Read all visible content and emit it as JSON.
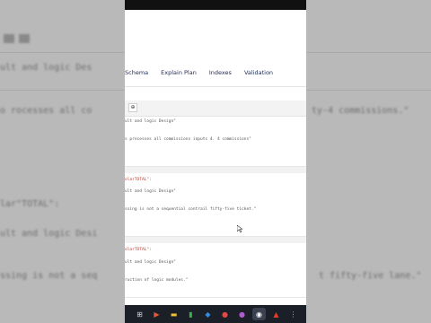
{
  "backdrop": {
    "left_lines": [
      "ult and logic Des",
      "o rocesses all co",
      "lar\"TOTAL\":",
      "ult and logic Desi",
      "ssing is not a seq"
    ],
    "right_lines": [
      "",
      "",
      "",
      "",
      "l\"lane.\""
    ]
  },
  "tabs": [
    {
      "label": "Schema"
    },
    {
      "label": "Explain Plan"
    },
    {
      "label": "Indexes"
    },
    {
      "label": "Validation"
    }
  ],
  "toolbar": {
    "button_glyph": "⊕"
  },
  "results": [
    {
      "line1": "ult and logic Design\"",
      "line2": "s processes all commissions inputs 4. 4 commissions\""
    },
    {
      "key": "olarTOTAL\":",
      "line1": "ult and logic Design\"",
      "line2": "ssing is not a sequential contrail fifty-five ticket.\""
    },
    {
      "key": "olarTOTAL\":",
      "line1": "ult and logic Design\"",
      "line2": "ruction of logic modules.\""
    }
  ],
  "taskbar": {
    "icons": [
      {
        "name": "start-icon",
        "glyph": "⊞",
        "color": "#d0d3da"
      },
      {
        "name": "terminal-icon",
        "glyph": "▶",
        "color": "#e35a3a"
      },
      {
        "name": "files-icon",
        "glyph": "▬",
        "color": "#f2c230"
      },
      {
        "name": "spreadsheet-icon",
        "glyph": "▮",
        "color": "#3fae49"
      },
      {
        "name": "vscode-icon",
        "glyph": "◆",
        "color": "#2f8de4"
      },
      {
        "name": "chrome-icon",
        "glyph": "●",
        "color": "#de4a4a"
      },
      {
        "name": "app-icon",
        "glyph": "●",
        "color": "#b25bd1"
      },
      {
        "name": "obs-icon",
        "glyph": "◉",
        "color": "#ffffff"
      },
      {
        "name": "pdf-icon",
        "glyph": "▲",
        "color": "#e03b2f"
      },
      {
        "name": "more-icon",
        "glyph": "⋮",
        "color": "#aab0bb"
      }
    ]
  }
}
